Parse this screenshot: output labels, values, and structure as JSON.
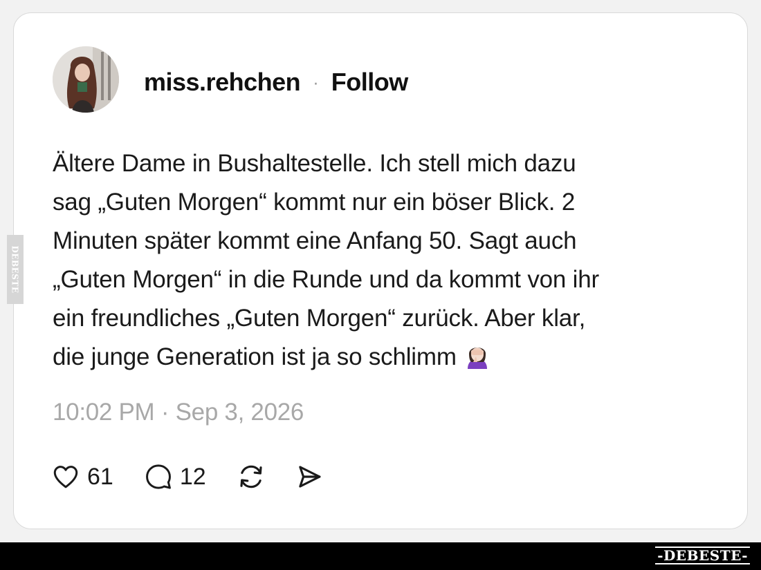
{
  "post": {
    "username": "miss.rehchen",
    "separator": "·",
    "follow_label": "Follow",
    "text_lines": [
      "Ältere Dame in Bushaltestelle. Ich stell mich dazu",
      "sag „Guten Morgen“ kommt nur ein böser Blick. 2",
      "Minuten später kommt eine Anfang 50. Sagt auch",
      "„Guten Morgen“ in die Runde und da kommt von ihr",
      "ein freundliches „Guten Morgen“ zurück. Aber klar,",
      "die junge Generation ist ja so schlimm"
    ],
    "emoji": "facepalm-woman-emoji",
    "timestamp": "10:02 PM · Sep 3, 2026"
  },
  "actions": {
    "like_icon": "heart-icon",
    "like_count": "61",
    "reply_icon": "comment-icon",
    "reply_count": "12",
    "repost_icon": "repost-icon",
    "share_icon": "share-icon"
  },
  "watermark": {
    "side_text": "DEBESTE",
    "footer_text": "-DEBESTE-"
  },
  "colors": {
    "background": "#f2f2f2",
    "card": "#ffffff",
    "text": "#1a1a1a",
    "muted": "#a8a8a8",
    "footer": "#000000"
  }
}
